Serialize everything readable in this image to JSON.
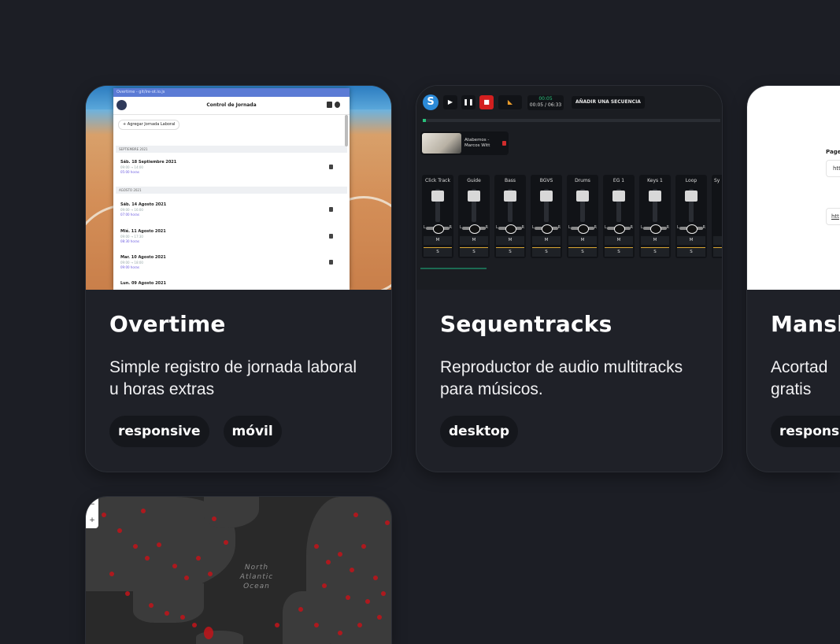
{
  "projects": [
    {
      "title": "Overtime",
      "description": "Simple registro de jornada laboral u horas extras",
      "tags": [
        "responsive",
        "móvil"
      ],
      "thumb": {
        "window_bar": "Overtime - git/ire-ot.io.js",
        "header_title": "Control de Jornada",
        "add_button": "Agregar Jornada Laboral",
        "sections": [
          "SEPTIEMBRE 2021",
          "AGOSTO 2021"
        ],
        "entries": [
          {
            "date": "Sáb. 18 Septiembre 2021",
            "time": "09:00 → 14:00",
            "hours": "05:00 horas"
          },
          {
            "date": "Sáb. 14 Agosto 2021",
            "time": "09:00 → 16:00",
            "hours": "07:00 horas"
          },
          {
            "date": "Mié. 11 Agosto 2021",
            "time": "09:00 → 17:30",
            "hours": "08:30 horas"
          },
          {
            "date": "Mar. 10 Agosto 2021",
            "time": "09:00 → 18:00",
            "hours": "09:00 horas"
          },
          {
            "date": "Lun. 09 Agosto 2021",
            "time": "",
            "hours": ""
          }
        ]
      }
    },
    {
      "title": "Sequentracks",
      "description": "Reproductor de audio multitracks para músicos.",
      "tags": [
        "desktop"
      ],
      "thumb": {
        "logo": "S",
        "time_current": "00:05",
        "time_display": "00:05 / 06:33",
        "add_sequence": "AÑADIR UNA SECUENCIA",
        "song_name": "Atabemos - Marcos Witt",
        "channels": [
          "Click Track",
          "Guide",
          "Bass",
          "BGVS",
          "Drums",
          "EG 1",
          "Keys 1",
          "Loop",
          "Sy"
        ],
        "mute_label": "M",
        "solo_label": "S",
        "pan_left": "L",
        "pan_right": "R"
      }
    },
    {
      "title": "Mansh",
      "description": "Acortad gratis",
      "tags": [
        "responsi"
      ],
      "thumb": {
        "page_label": "Page y",
        "field_1": "htt",
        "field_2": "htt"
      }
    },
    {
      "title": "",
      "description": "",
      "tags": [],
      "thumb": {
        "ocean_label": "North Atlantic Ocean",
        "zoom_in": "+",
        "zoom_out": "−",
        "land_color": "#3b3b3b",
        "dot_color": "#c2141a"
      }
    }
  ],
  "colors": {
    "page_bg": "#1c1e25",
    "card_bg": "#1f2128",
    "tag_bg": "#15171c",
    "accent_blue": "#2b8ad8",
    "accent_green": "#28c07a"
  }
}
